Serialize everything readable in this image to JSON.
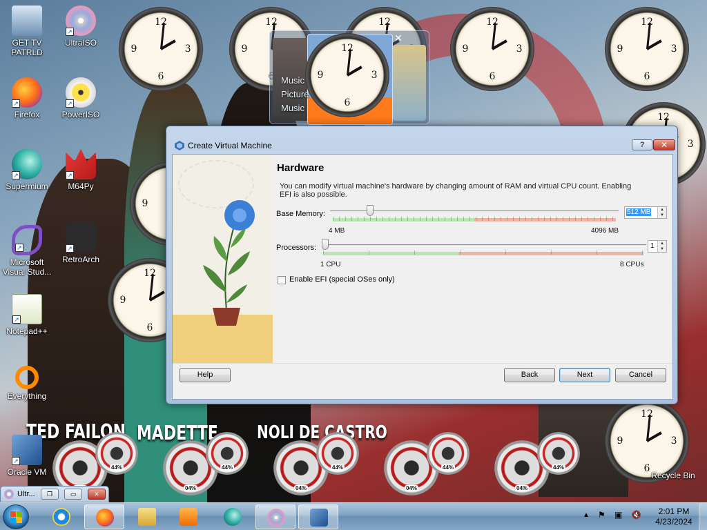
{
  "desktop": {
    "icons": [
      {
        "label": "GET TV PATRLD",
        "name": "get-tv-patrld",
        "icon": "computer-icon"
      },
      {
        "label": "UltraISO",
        "name": "ultraiso",
        "icon": "disc-icon"
      },
      {
        "label": "Firefox",
        "name": "firefox",
        "icon": "firefox-icon"
      },
      {
        "label": "PowerISO",
        "name": "poweriso",
        "icon": "disc-icon"
      },
      {
        "label": "Supermium",
        "name": "supermium",
        "icon": "browser-icon"
      },
      {
        "label": "M64Py",
        "name": "m64py",
        "icon": "game-icon"
      },
      {
        "label": "Microsoft Visual Stud...",
        "name": "microsoft-visual-studio",
        "icon": "visual-studio-icon"
      },
      {
        "label": "RetroArch",
        "name": "retroarch",
        "icon": "retroarch-icon"
      },
      {
        "label": "Notepad++",
        "name": "notepad-plus-plus",
        "icon": "notepad-icon"
      },
      {
        "label": "Everything",
        "name": "everything",
        "icon": "search-icon"
      },
      {
        "label": "Oracle VM",
        "name": "oracle-vm",
        "icon": "virtualbox-icon"
      },
      {
        "label": "Recycle Bin",
        "name": "recycle-bin",
        "icon": "recycle-bin-icon"
      }
    ],
    "gauge_cpu": "04%",
    "gauge_mem": "44%",
    "banners": {
      "left": "TED FAILON",
      "mid": "MADETTE",
      "right": "NOLI DE CASTRO"
    },
    "flip_menu": [
      "Music",
      "Picture",
      "Music"
    ]
  },
  "dialog": {
    "title": "Create Virtual Machine",
    "help_glyph": "?",
    "close_glyph": "✕",
    "heading": "Hardware",
    "description": "You can modify virtual machine's hardware by changing amount of RAM and virtual CPU count. Enabling EFI is also possible.",
    "memory": {
      "label": "Base Memory:",
      "value": "512 MB",
      "min_label": "4 MB",
      "max_label": "4096 MB",
      "level": 0.125
    },
    "processors": {
      "label": "Processors:",
      "value": "1",
      "min_label": "1 CPU",
      "max_label": "8 CPUs",
      "level": 0
    },
    "efi_label": "Enable EFI (special OSes only)",
    "efi_checked": false,
    "buttons": {
      "help": "Help",
      "back": "Back",
      "next": "Next",
      "cancel": "Cancel"
    }
  },
  "mini_window": {
    "title": "Ultr..."
  },
  "taskbar": {
    "time": "2:01 PM",
    "date": "4/23/2024",
    "items": [
      "internet-explorer",
      "firefox",
      "file-explorer",
      "media-player",
      "supermium",
      "ultraiso",
      "virtualbox"
    ]
  },
  "colors": {
    "accent": "#3399ff",
    "titlebar": "#b9cde3",
    "close": "#c0392b",
    "green_zone": "#b8e6b0",
    "red_zone": "#f2b3a5"
  }
}
